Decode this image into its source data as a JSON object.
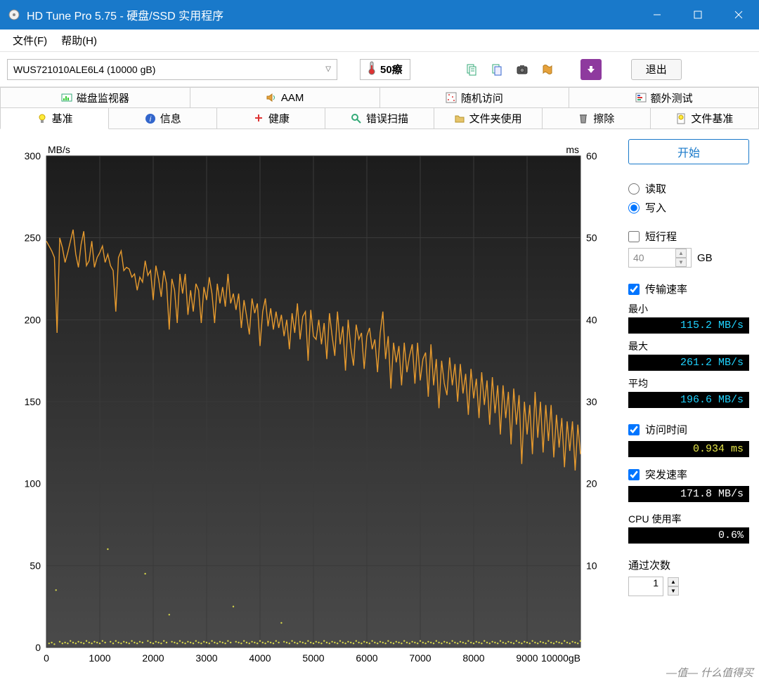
{
  "window": {
    "title": "HD Tune Pro 5.75 - 硬盘/SSD 实用程序"
  },
  "menu": {
    "file": "文件(F)",
    "help": "帮助(H)"
  },
  "toolbar": {
    "drive": "WUS721010ALE6L4 (10000 gB)",
    "temp": "50瘵",
    "exit": "退出"
  },
  "tabs_row1": [
    {
      "label": "磁盘监视器",
      "icon": "monitor-icon"
    },
    {
      "label": "AAM",
      "icon": "speaker-icon"
    },
    {
      "label": "随机访问",
      "icon": "random-icon"
    },
    {
      "label": "额外测试",
      "icon": "extra-icon"
    }
  ],
  "tabs_row2": [
    {
      "label": "基准",
      "icon": "bulb-icon",
      "active": true
    },
    {
      "label": "信息",
      "icon": "info-icon"
    },
    {
      "label": "健康",
      "icon": "health-icon"
    },
    {
      "label": "错误扫描",
      "icon": "scan-icon"
    },
    {
      "label": "文件夹使用",
      "icon": "folder-icon"
    },
    {
      "label": "擦除",
      "icon": "erase-icon"
    },
    {
      "label": "文件基准",
      "icon": "filebench-icon"
    }
  ],
  "side": {
    "start": "开始",
    "read": "读取",
    "write": "写入",
    "short_stroke": "短行程",
    "short_stroke_val": "40",
    "short_stroke_unit": "GB",
    "transfer_rate": "传输速率",
    "min_label": "最小",
    "min_val": "115.2 MB/s",
    "max_label": "最大",
    "max_val": "261.2 MB/s",
    "avg_label": "平均",
    "avg_val": "196.6 MB/s",
    "access_time": "访问时间",
    "access_val": "0.934 ms",
    "burst": "突发速率",
    "burst_val": "171.8 MB/s",
    "cpu": "CPU 使用率",
    "cpu_val": "0.6%",
    "passes": "通过次数",
    "passes_val": "1"
  },
  "watermark": "什么值得买",
  "chart_data": {
    "type": "line+scatter",
    "title": "",
    "x_unit": "gB",
    "xlim": [
      0,
      10000
    ],
    "xticks": [
      0,
      1000,
      2000,
      3000,
      4000,
      5000,
      6000,
      7000,
      8000,
      9000,
      10000
    ],
    "y_left_label": "MB/s",
    "y_left_lim": [
      0,
      300
    ],
    "y_left_ticks": [
      0,
      50,
      100,
      150,
      200,
      250,
      300
    ],
    "y_right_label": "ms",
    "y_right_lim": [
      0,
      60
    ],
    "y_right_ticks": [
      10,
      20,
      30,
      40,
      50,
      60
    ],
    "series": [
      {
        "name": "transfer",
        "axis": "left",
        "color": "#e69a2e",
        "x_step": 50,
        "values": [
          248,
          245,
          242,
          238,
          192,
          250,
          244,
          235,
          241,
          248,
          255,
          240,
          232,
          246,
          254,
          233,
          236,
          248,
          232,
          238,
          241,
          245,
          235,
          240,
          233,
          230,
          205,
          238,
          242,
          230,
          232,
          231,
          226,
          228,
          218,
          226,
          223,
          236,
          227,
          230,
          212,
          233,
          225,
          214,
          230,
          222,
          194,
          225,
          218,
          198,
          228,
          216,
          228,
          203,
          218,
          205,
          222,
          218,
          198,
          220,
          212,
          226,
          216,
          198,
          222,
          210,
          220,
          208,
          228,
          210,
          216,
          206,
          216,
          195,
          212,
          202,
          191,
          213,
          204,
          210,
          184,
          205,
          213,
          196,
          207,
          194,
          205,
          195,
          203,
          190,
          200,
          182,
          204,
          192,
          210,
          188,
          202,
          205,
          175,
          206,
          190,
          188,
          200,
          185,
          198,
          176,
          204,
          190,
          178,
          205,
          185,
          196,
          169,
          200,
          183,
          172,
          197,
          188,
          192,
          170,
          190,
          195,
          182,
          188,
          168,
          192,
          205,
          176,
          190,
          158,
          186,
          174,
          184,
          160,
          186,
          168,
          178,
          185,
          161,
          186,
          163,
          176,
          180,
          153,
          185,
          160,
          176,
          146,
          175,
          161,
          154,
          177,
          160,
          173,
          150,
          173,
          155,
          167,
          142,
          170,
          152,
          164,
          140,
          168,
          148,
          163,
          136,
          165,
          143,
          160,
          130,
          160,
          140,
          156,
          124,
          158,
          136,
          154,
          112,
          150,
          130,
          148,
          118,
          156,
          128,
          150,
          119,
          148,
          126,
          148,
          116,
          142,
          122,
          140,
          110,
          138,
          120,
          138,
          108,
          136,
          118
        ]
      },
      {
        "name": "access",
        "axis": "right",
        "color": "#d6d64a",
        "points": [
          [
            50,
            0.5
          ],
          [
            100,
            0.6
          ],
          [
            150,
            0.4
          ],
          [
            180,
            7
          ],
          [
            250,
            0.7
          ],
          [
            300,
            0.5
          ],
          [
            350,
            0.6
          ],
          [
            400,
            0.5
          ],
          [
            450,
            0.8
          ],
          [
            500,
            0.6
          ],
          [
            550,
            0.5
          ],
          [
            600,
            0.7
          ],
          [
            650,
            0.6
          ],
          [
            700,
            0.5
          ],
          [
            750,
            0.8
          ],
          [
            800,
            0.6
          ],
          [
            850,
            0.5
          ],
          [
            900,
            0.7
          ],
          [
            950,
            0.6
          ],
          [
            1000,
            0.5
          ],
          [
            1050,
            0.8
          ],
          [
            1100,
            0.6
          ],
          [
            1150,
            12
          ],
          [
            1200,
            0.7
          ],
          [
            1250,
            0.5
          ],
          [
            1300,
            0.8
          ],
          [
            1350,
            0.6
          ],
          [
            1400,
            0.5
          ],
          [
            1450,
            0.7
          ],
          [
            1500,
            0.6
          ],
          [
            1550,
            0.5
          ],
          [
            1600,
            0.8
          ],
          [
            1650,
            0.6
          ],
          [
            1700,
            0.5
          ],
          [
            1750,
            0.7
          ],
          [
            1800,
            0.6
          ],
          [
            1850,
            9
          ],
          [
            1900,
            0.8
          ],
          [
            1950,
            0.6
          ],
          [
            2000,
            0.5
          ],
          [
            2050,
            0.7
          ],
          [
            2100,
            0.6
          ],
          [
            2150,
            0.5
          ],
          [
            2200,
            0.8
          ],
          [
            2250,
            0.6
          ],
          [
            2300,
            4
          ],
          [
            2350,
            0.7
          ],
          [
            2400,
            0.6
          ],
          [
            2450,
            0.5
          ],
          [
            2500,
            0.8
          ],
          [
            2550,
            0.6
          ],
          [
            2600,
            0.5
          ],
          [
            2650,
            0.7
          ],
          [
            2700,
            0.6
          ],
          [
            2750,
            0.5
          ],
          [
            2800,
            0.8
          ],
          [
            2850,
            0.6
          ],
          [
            2900,
            0.5
          ],
          [
            2950,
            0.7
          ],
          [
            3000,
            0.6
          ],
          [
            3050,
            0.5
          ],
          [
            3100,
            0.8
          ],
          [
            3150,
            0.6
          ],
          [
            3200,
            0.5
          ],
          [
            3250,
            0.7
          ],
          [
            3300,
            0.6
          ],
          [
            3350,
            0.5
          ],
          [
            3400,
            0.8
          ],
          [
            3450,
            0.6
          ],
          [
            3500,
            5
          ],
          [
            3550,
            0.7
          ],
          [
            3600,
            0.6
          ],
          [
            3650,
            0.5
          ],
          [
            3700,
            0.8
          ],
          [
            3750,
            0.6
          ],
          [
            3800,
            0.5
          ],
          [
            3850,
            0.7
          ],
          [
            3900,
            0.6
          ],
          [
            3950,
            0.5
          ],
          [
            4000,
            0.8
          ],
          [
            4050,
            0.6
          ],
          [
            4100,
            0.5
          ],
          [
            4150,
            0.7
          ],
          [
            4200,
            0.6
          ],
          [
            4250,
            0.5
          ],
          [
            4300,
            0.8
          ],
          [
            4350,
            0.6
          ],
          [
            4400,
            3
          ],
          [
            4450,
            0.7
          ],
          [
            4500,
            0.6
          ],
          [
            4550,
            0.5
          ],
          [
            4600,
            0.8
          ],
          [
            4650,
            0.6
          ],
          [
            4700,
            0.5
          ],
          [
            4750,
            0.7
          ],
          [
            4800,
            0.6
          ],
          [
            4850,
            0.5
          ],
          [
            4900,
            0.8
          ],
          [
            4950,
            0.6
          ],
          [
            5000,
            0.5
          ],
          [
            5050,
            0.7
          ],
          [
            5100,
            0.6
          ],
          [
            5150,
            0.5
          ],
          [
            5200,
            0.8
          ],
          [
            5250,
            0.6
          ],
          [
            5300,
            0.5
          ],
          [
            5350,
            0.7
          ],
          [
            5400,
            0.6
          ],
          [
            5450,
            0.5
          ],
          [
            5500,
            0.8
          ],
          [
            5550,
            0.6
          ],
          [
            5600,
            0.5
          ],
          [
            5650,
            0.7
          ],
          [
            5700,
            0.6
          ],
          [
            5750,
            0.5
          ],
          [
            5800,
            0.8
          ],
          [
            5850,
            0.6
          ],
          [
            5900,
            0.5
          ],
          [
            5950,
            0.7
          ],
          [
            6000,
            0.6
          ],
          [
            6050,
            0.5
          ],
          [
            6100,
            0.8
          ],
          [
            6150,
            0.6
          ],
          [
            6200,
            0.5
          ],
          [
            6250,
            0.7
          ],
          [
            6300,
            0.6
          ],
          [
            6350,
            0.5
          ],
          [
            6400,
            0.8
          ],
          [
            6450,
            0.6
          ],
          [
            6500,
            0.5
          ],
          [
            6550,
            0.7
          ],
          [
            6600,
            0.6
          ],
          [
            6650,
            0.5
          ],
          [
            6700,
            0.8
          ],
          [
            6750,
            0.6
          ],
          [
            6800,
            0.5
          ],
          [
            6850,
            0.7
          ],
          [
            6900,
            0.6
          ],
          [
            6950,
            0.5
          ],
          [
            7000,
            0.8
          ],
          [
            7050,
            0.6
          ],
          [
            7100,
            0.5
          ],
          [
            7150,
            0.7
          ],
          [
            7200,
            0.6
          ],
          [
            7250,
            0.5
          ],
          [
            7300,
            0.8
          ],
          [
            7350,
            0.6
          ],
          [
            7400,
            0.5
          ],
          [
            7450,
            0.7
          ],
          [
            7500,
            0.6
          ],
          [
            7550,
            0.5
          ],
          [
            7600,
            0.8
          ],
          [
            7650,
            0.6
          ],
          [
            7700,
            0.5
          ],
          [
            7750,
            0.7
          ],
          [
            7800,
            0.6
          ],
          [
            7850,
            0.5
          ],
          [
            7900,
            0.8
          ],
          [
            7950,
            0.6
          ],
          [
            8000,
            0.5
          ],
          [
            8050,
            0.7
          ],
          [
            8100,
            0.6
          ],
          [
            8150,
            0.5
          ],
          [
            8200,
            0.8
          ],
          [
            8250,
            0.6
          ],
          [
            8300,
            0.5
          ],
          [
            8350,
            0.7
          ],
          [
            8400,
            0.6
          ],
          [
            8450,
            0.5
          ],
          [
            8500,
            0.8
          ],
          [
            8550,
            0.6
          ],
          [
            8600,
            0.5
          ],
          [
            8650,
            0.7
          ],
          [
            8700,
            0.6
          ],
          [
            8750,
            0.5
          ],
          [
            8800,
            0.8
          ],
          [
            8850,
            0.6
          ],
          [
            8900,
            0.5
          ],
          [
            8950,
            0.7
          ],
          [
            9000,
            0.6
          ],
          [
            9050,
            0.5
          ],
          [
            9100,
            0.8
          ],
          [
            9150,
            0.6
          ],
          [
            9200,
            0.5
          ],
          [
            9250,
            0.7
          ],
          [
            9300,
            0.6
          ],
          [
            9350,
            0.5
          ],
          [
            9400,
            0.8
          ],
          [
            9450,
            0.6
          ],
          [
            9500,
            0.5
          ],
          [
            9550,
            0.7
          ],
          [
            9600,
            0.6
          ],
          [
            9650,
            0.5
          ],
          [
            9700,
            0.8
          ],
          [
            9750,
            0.6
          ],
          [
            9800,
            0.5
          ],
          [
            9850,
            0.7
          ],
          [
            9900,
            0.6
          ],
          [
            9950,
            0.5
          ],
          [
            10000,
            0.8
          ]
        ]
      }
    ]
  }
}
